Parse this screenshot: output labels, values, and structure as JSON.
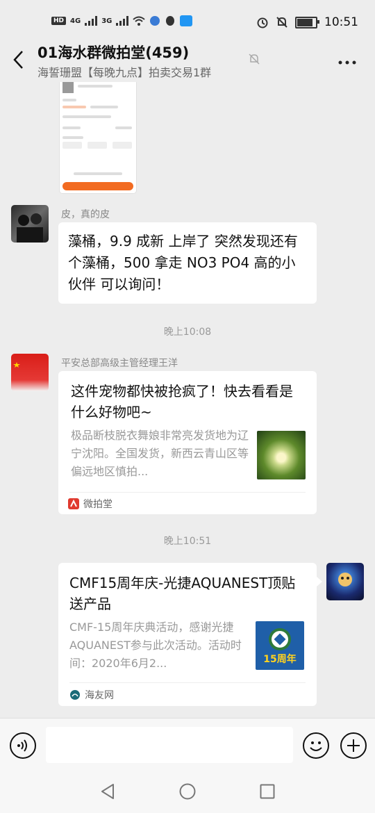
{
  "status_bar": {
    "left_indicators": [
      "HD",
      "4G",
      "3G"
    ],
    "time": "10:51",
    "battery_level": 0.85
  },
  "header": {
    "title": "01海水群微拍堂(459)",
    "subtitle": "海誓珊盟【每晚九点】拍卖交易1群"
  },
  "messages": [
    {
      "type": "text",
      "sender": "皮，真的皮",
      "text": "藻桶，9.9 成新 上岸了 突然发现还有个藻桶，500 拿走  NO3 PO4 高的小伙伴 可以询问！"
    },
    {
      "type": "time",
      "text": "晚上10:08"
    },
    {
      "type": "card",
      "sender": "平安总部高级主管经理王洋",
      "title": "这件宠物都快被抢疯了！快去看看是什么好物吧~",
      "desc": "极品断枝脱衣舞娘非常亮发货地为辽宁沈阳。全国发货，新西云青山区等偏远地区慎拍...",
      "source": "微拍堂"
    },
    {
      "type": "time",
      "text": "晚上10:51"
    },
    {
      "type": "card",
      "outgoing": true,
      "title": "CMF15周年庆-光捷AQUANEST顶贴送产品",
      "desc": "CMF-15周年庆典活动，感谢光捷AQUANEST参与此次活动。活动时间：2020年6月2...",
      "thumb_text": "15周年",
      "source": "海友网"
    }
  ],
  "input": {
    "placeholder": ""
  },
  "colors": {
    "accent": "#f26b21",
    "background": "#ededed",
    "bubble": "#ffffff"
  }
}
